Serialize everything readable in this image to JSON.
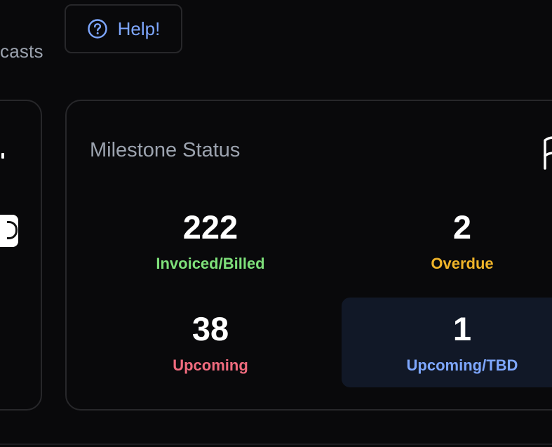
{
  "header": {
    "tab_partial_label": "casts",
    "help_label": "Help!",
    "help_icon": "question-circle-icon"
  },
  "milestone_card": {
    "title": "Milestone Status",
    "flag_icon": "flag-icon",
    "stats": [
      {
        "value": "222",
        "label": "Invoiced/Billed",
        "color": "#7ee07a"
      },
      {
        "value": "2",
        "label": "Overdue",
        "color": "#f0b429"
      },
      {
        "value": "38",
        "label": "Upcoming",
        "color": "#f06b7e"
      },
      {
        "value": "1",
        "label": "Upcoming/TBD",
        "color": "#7ea7ff"
      }
    ]
  },
  "colors": {
    "background": "#09090b",
    "border": "#27272a",
    "accent": "#7ea7ff",
    "highlight_bg": "#111827"
  }
}
